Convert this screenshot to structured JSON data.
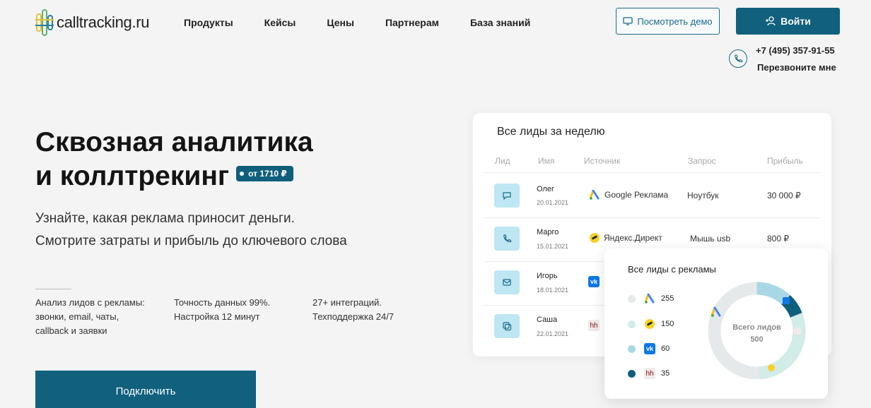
{
  "header": {
    "logo": "calltracking.ru",
    "nav": [
      "Продукты",
      "Кейсы",
      "Цены",
      "Партнерам",
      "База знаний"
    ],
    "demo_button": "Посмотреть демо",
    "login_button": "Войти",
    "phone": "+7 (495) 357-91-55",
    "callback": "Перезвоните мне"
  },
  "hero": {
    "title_line1": "Сквозная аналитика",
    "title_line2": "и коллтрекинг",
    "price_badge": "от 1710 ₽",
    "subtitle_line1": "Узнайте, какая реклама приносит деньги.",
    "subtitle_line2": "Смотрите затраты и прибыль до ключевого слова",
    "features": [
      [
        "Анализ лидов с рекламы:",
        "звонки, email, чаты,",
        "callback и заявки"
      ],
      [
        "Точность данных 99%.",
        "Настройка 12 минут"
      ],
      [
        "27+ интеграций.",
        "Техподдержка 24/7"
      ]
    ],
    "connect_button": "Подключить"
  },
  "leads_card": {
    "title": "Все лиды за неделю",
    "columns": [
      "Лид",
      "Имя",
      "Источник",
      "Запрос",
      "Прибыль"
    ],
    "rows": [
      {
        "type": "chat",
        "name": "Олег",
        "date": "20.01.2021",
        "source": "Google Реклама",
        "source_icon": "google-ads-icon",
        "query": "Ноутбук",
        "profit": "30 000 ₽"
      },
      {
        "type": "call",
        "name": "Марго",
        "date": "15.01.2021",
        "source": "Яндекс.Директ",
        "source_icon": "yandex-direct-icon",
        "query": "Мышь usb",
        "profit": "800 ₽"
      },
      {
        "type": "email",
        "name": "Игорь",
        "date": "18.01.2021",
        "source": "",
        "source_icon": "vk-icon",
        "query": "",
        "profit": ""
      },
      {
        "type": "form",
        "name": "Саша",
        "date": "22.01.2021",
        "source": "",
        "source_icon": "hh-icon",
        "query": "",
        "profit": ""
      }
    ]
  },
  "donut_card": {
    "title": "Все лиды с рекламы",
    "center_label": "Всего лидов",
    "total": "500",
    "legend": [
      {
        "icon": "google-ads-icon",
        "value": "255",
        "color": "#e6e9ea"
      },
      {
        "icon": "yandex-direct-icon",
        "value": "150",
        "color": "#d2ece8"
      },
      {
        "icon": "vk-icon",
        "value": "60",
        "color": "#a8d8e6"
      },
      {
        "icon": "hh-icon",
        "value": "35",
        "color": "#0f5f7c"
      }
    ]
  }
}
